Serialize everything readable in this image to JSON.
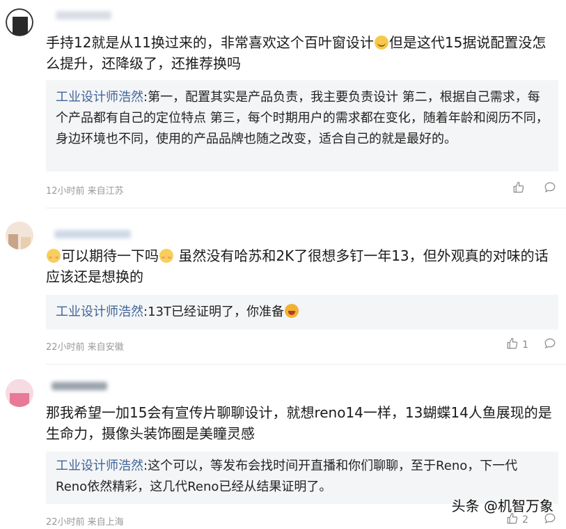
{
  "comments": [
    {
      "body": "手持12就是从11换过来的，非常喜欢这个百叶窗设计",
      "body_tail": "但是这代15据说配置没怎么提升，还降级了，还推荐换吗",
      "reply_author": "工业设计师浩然",
      "reply_text": ":第一，配置其实是产品负责，我主要负责设计 第二，根据自己需求，每个产品都有自己的定位特点 第三，每个时期用户的需求都在变化，随着年龄和阅历不同，身边环境也不同，使用的产品品牌也随之改变，适合自己的就是最好的。",
      "time": "12小时前 来自江苏",
      "likes": ""
    },
    {
      "body_head": "可以期待一下吗",
      "body": " 虽然没有哈苏和2K了很想多钉一年13，但外观真的对味的话应该还是想换的",
      "reply_author": "工业设计师浩然",
      "reply_text": ":13T已经证明了，你准备",
      "time": "22小时前 来自安徽",
      "likes": "1"
    },
    {
      "body": "那我希望一加15会有宣传片聊聊设计，就想reno14一样，13蝴蝶14人鱼展现的是生命力，摄像头装饰圈是美瞳灵感",
      "reply_author": "工业设计师浩然",
      "reply_text": ":这个可以，等发布会找时间开直播和你们聊聊，至于Reno，下一代Reno依然精彩，这几代Reno已经从结果证明了。",
      "time": "22小时前 来自上海",
      "likes": "2"
    }
  ],
  "watermark": "头条 @机智万象",
  "icons": {
    "like": "thumbs-up-icon",
    "reply": "comment-bubble-icon"
  },
  "colors": {
    "author": "#406599",
    "reply_bg": "#f4f5f6",
    "meta": "#999999"
  }
}
